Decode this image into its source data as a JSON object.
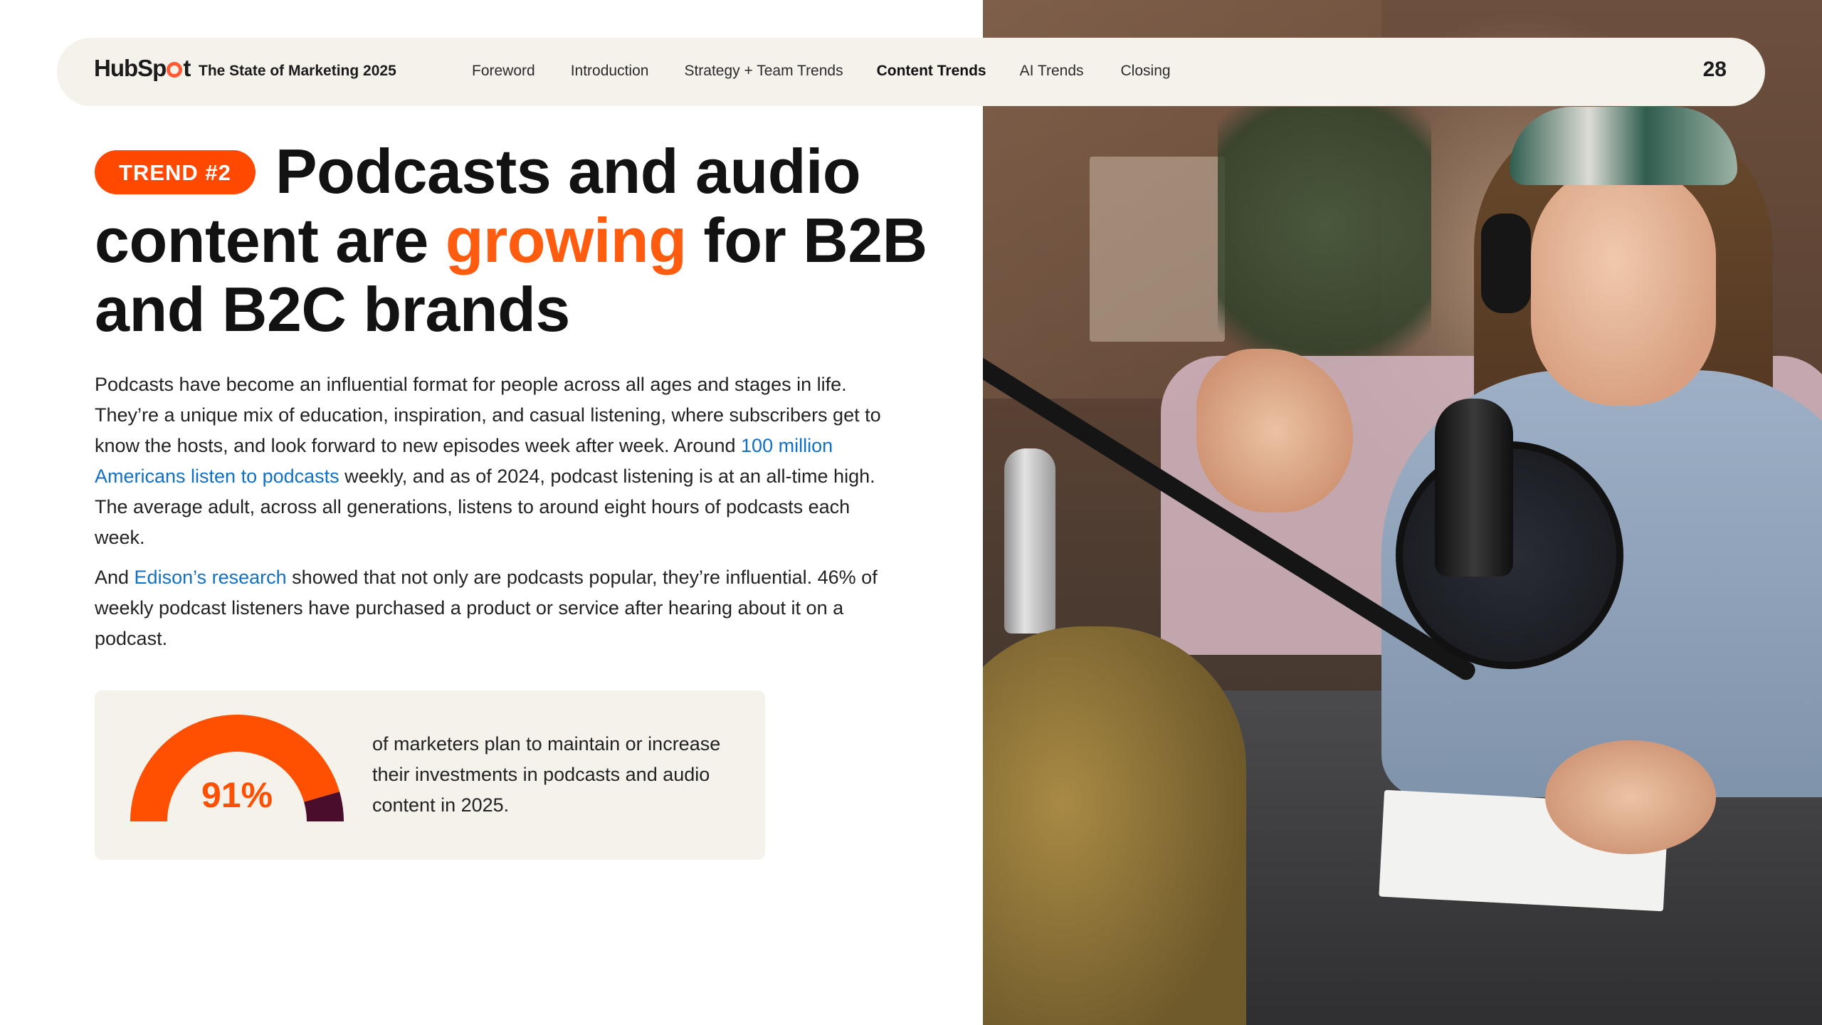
{
  "nav": {
    "logo": "HubSpot",
    "report_title": "The State of Marketing 2025",
    "links": [
      "Foreword",
      "Introduction",
      "Strategy + Team Trends",
      "Content Trends",
      "AI Trends",
      "Closing"
    ],
    "active_link": "Content Trends",
    "page_number": "28"
  },
  "headline": {
    "badge": "TREND #2",
    "part1": "Podcasts and audio content are ",
    "accent": "growing",
    "part2": " for B2B and B2C brands"
  },
  "body": {
    "p1_a": "Podcasts have become an influential format for people across all ages and stages in life. They’re a unique mix of education, inspiration, and casual listening, where subscribers get to know the hosts, and look forward to new episodes week after week. Around ",
    "p1_link": "100 million Americans listen to podcasts",
    "p1_b": " weekly, and as of 2024, podcast listening is at an all-time high. The average adult, across all generations, listens to around eight hours of podcasts each week.",
    "p2_a": "And ",
    "p2_link": "Edison’s research",
    "p2_b": " showed that not only are podcasts popular, they’re influential. 46% of weekly podcast listeners have purchased a product or service after hearing about it on a podcast."
  },
  "stat": {
    "value_label": "91%",
    "value": 91,
    "description": "of marketers plan to maintain or increase their investments in podcasts and audio content in 2025.",
    "colors": {
      "fill": "#ff4f00",
      "remainder": "#4a0d2b"
    }
  },
  "colors": {
    "accent": "#ff5c10",
    "link": "#1170c4",
    "badge": "#ff4800",
    "nav_bg": "#f5f2ec"
  }
}
